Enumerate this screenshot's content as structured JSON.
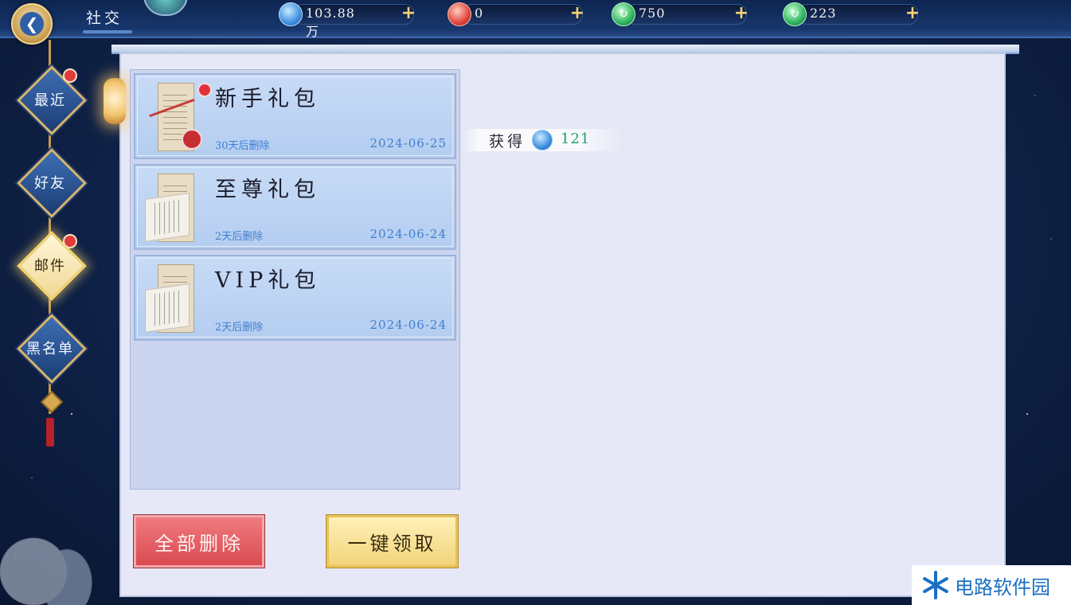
{
  "header": {
    "title": "社交",
    "resources": [
      {
        "icon": "blue-gem-icon",
        "value": "103.88万"
      },
      {
        "icon": "red-gem-icon",
        "value": "0"
      },
      {
        "icon": "jade-coin-icon",
        "value": "750"
      },
      {
        "icon": "jade-coin-icon",
        "value": "223"
      }
    ],
    "plus_symbol": "+"
  },
  "nav": {
    "items": [
      {
        "label": "最近",
        "badge": true,
        "active": false
      },
      {
        "label": "好友",
        "badge": false,
        "active": false
      },
      {
        "label": "邮件",
        "badge": true,
        "active": true
      },
      {
        "label": "黑名单",
        "badge": false,
        "active": false
      }
    ]
  },
  "mails": [
    {
      "title": "新手礼包",
      "expire": "30天后删除",
      "date": "2024-06-25",
      "unread": true
    },
    {
      "title": "至尊礼包",
      "expire": "2天后删除",
      "date": "2024-06-24",
      "unread": false
    },
    {
      "title": "VIP礼包",
      "expire": "2天后删除",
      "date": "2024-06-24",
      "unread": false
    }
  ],
  "reward": {
    "label": "获得",
    "icon": "blue-gem-icon",
    "amount": "121"
  },
  "actions": {
    "delete_all": "全部删除",
    "claim_all": "一键领取"
  },
  "watermark": {
    "text": "电路软件园"
  },
  "colors": {
    "accent_gold": "#f2d47a",
    "delete_red": "#d94b51",
    "date_blue": "#3e7fd1",
    "reward_green": "#22a06b"
  }
}
